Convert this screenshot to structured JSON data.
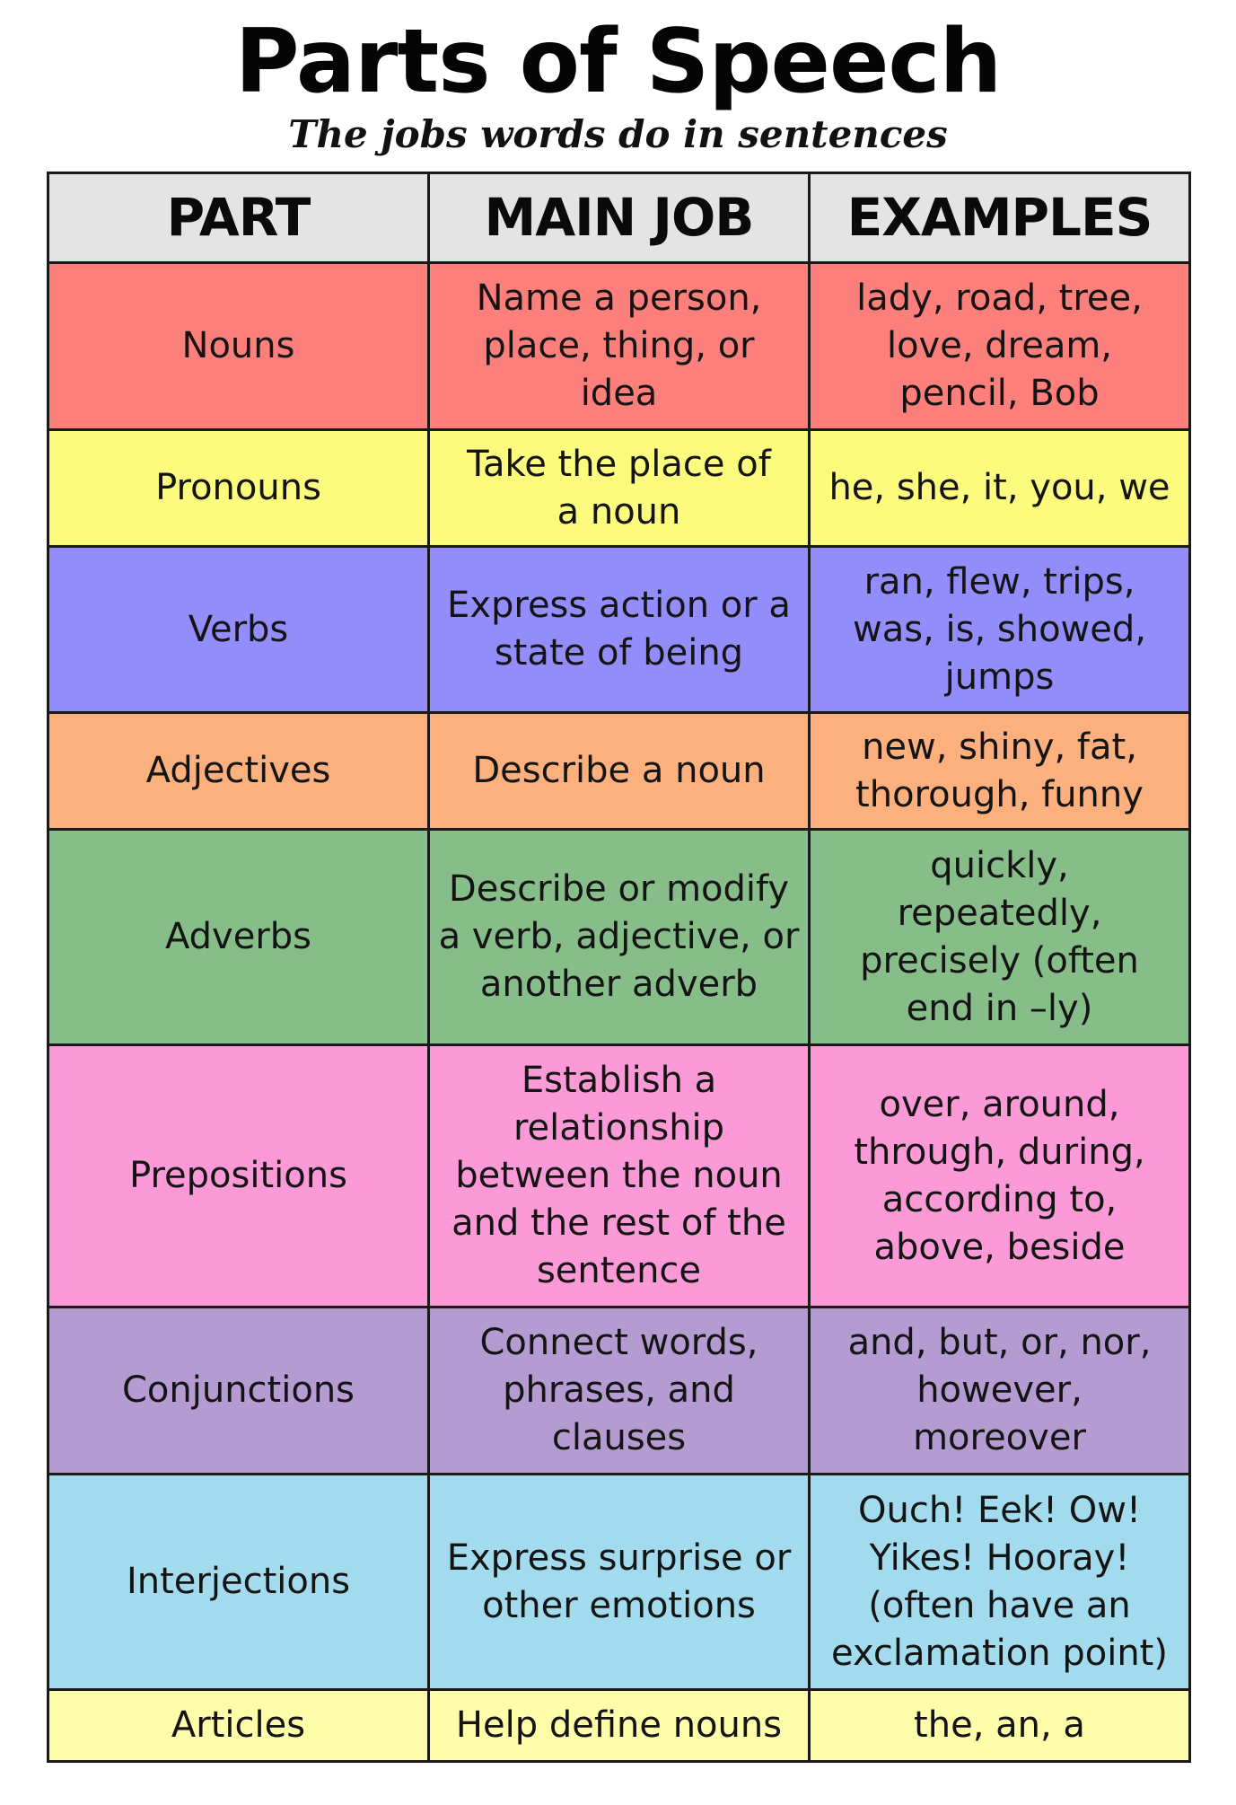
{
  "title": "Parts of Speech",
  "subtitle": "The jobs words do in sentences",
  "headers": {
    "part": "PART",
    "main_job": "MAIN JOB",
    "examples": "EXAMPLES"
  },
  "header_color": "#e4e4e4",
  "rows": [
    {
      "part": "Nouns",
      "main_job": "Name a person, place, thing, or idea",
      "examples": "lady, road, tree, love, dream, pencil, Bob",
      "color": "#fd7f7c"
    },
    {
      "part": "Pronouns",
      "main_job": "Take the place of a noun",
      "examples": "he, she, it, you, we",
      "color": "#fdfb7d"
    },
    {
      "part": "Verbs",
      "main_job": "Express action or a state of being",
      "examples": "ran, flew, trips, was, is, showed, jumps",
      "color": "#938dfc"
    },
    {
      "part": "Adjectives",
      "main_job": "Describe a noun",
      "examples": "new, shiny, fat, thorough, funny",
      "color": "#fcb07e"
    },
    {
      "part": "Adverbs",
      "main_job": "Describe or modify a verb, adjective, or another adverb",
      "examples": "quickly, repeatedly, precisely (often end in –ly)",
      "color": "#86bd89"
    },
    {
      "part": "Prepositions",
      "main_job": "Establish a relationship between the noun and the rest of the sentence",
      "examples": "over, around, through, during, according to, above, beside",
      "color": "#fb9ad6"
    },
    {
      "part": "Conjunctions",
      "main_job": "Connect words, phrases, and clauses",
      "examples": "and, but, or, nor, however, moreover",
      "color": "#b49bd2"
    },
    {
      "part": "Interjections",
      "main_job": "Express surprise or other emotions",
      "examples": "Ouch! Eek!  Ow! Yikes! Hooray! (often have an exclamation point)",
      "color": "#a2dbed"
    },
    {
      "part": "Articles",
      "main_job": "Help define nouns",
      "examples": "the, an, a",
      "color": "#fdfdaa"
    }
  ]
}
